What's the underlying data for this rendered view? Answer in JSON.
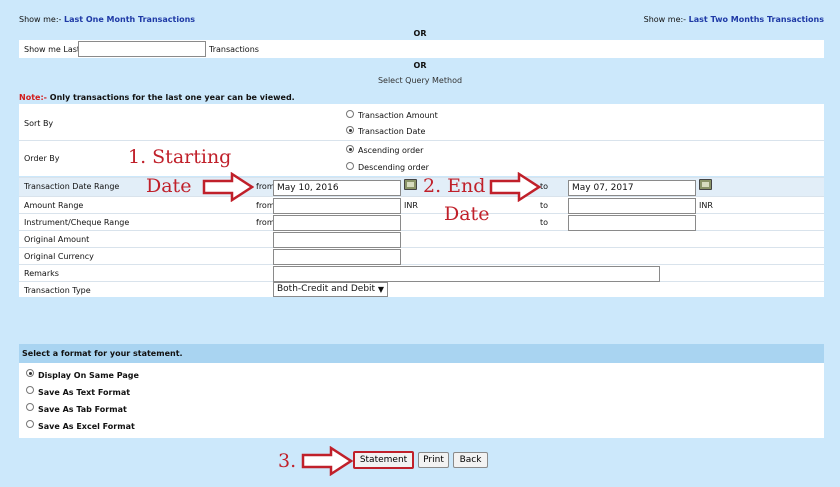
{
  "top": {
    "left_prefix": "Show me:-",
    "left_link": "Last One Month Transactions",
    "right_prefix": "Show me:-",
    "right_link": "Last Two Months Transactions",
    "or_1": "OR",
    "show_me_last_label": "Show me Last",
    "show_me_last_value": "",
    "transactions_suffix": "Transactions",
    "or_2": "OR",
    "select_query_method": "Select Query Method"
  },
  "note": {
    "prefix": "Note:-",
    "text": "Only transactions for the last one year can be viewed."
  },
  "sort_by": {
    "label": "Sort By",
    "options": [
      "Transaction Amount",
      "Transaction Date"
    ],
    "selected": "Transaction Date"
  },
  "order_by": {
    "label": "Order By",
    "options": [
      "Ascending order",
      "Descending order"
    ],
    "selected": "Ascending order"
  },
  "rows": {
    "date_range": {
      "label": "Transaction Date Range",
      "from_label": "from",
      "from_value": "May 10, 2016",
      "to_label": "to",
      "to_value": "May 07, 2017"
    },
    "amount_range": {
      "label": "Amount Range",
      "from_label": "from",
      "from_value": "",
      "unit1": "INR",
      "to_label": "to",
      "to_value": "",
      "unit2": "INR"
    },
    "cheque_range": {
      "label": "Instrument/Cheque Range",
      "from_label": "from",
      "from_value": "",
      "to_label": "to",
      "to_value": ""
    },
    "original_amount": {
      "label": "Original Amount",
      "value": ""
    },
    "original_currency": {
      "label": "Original Currency",
      "value": ""
    },
    "remarks": {
      "label": "Remarks",
      "value": ""
    },
    "transaction_type": {
      "label": "Transaction Type",
      "value": "Both-Credit and Debit"
    }
  },
  "format": {
    "header": "Select a format for your statement.",
    "options": [
      "Display On Same Page",
      "Save As Text Format",
      "Save As Tab Format",
      "Save As Excel Format"
    ],
    "selected": "Display On Same Page"
  },
  "buttons": {
    "statement": "Statement",
    "print": "Print",
    "back": "Back"
  },
  "annotations": {
    "a1_line1": "1. Starting",
    "a1_line2": "Date",
    "a2_line1": "2. End",
    "a2_line2": "Date",
    "a3": "3."
  },
  "colors": {
    "background": "#cce8fb",
    "link": "#1f3aa6",
    "annotation_red": "#c0202a",
    "note_red": "#d21c1c"
  }
}
